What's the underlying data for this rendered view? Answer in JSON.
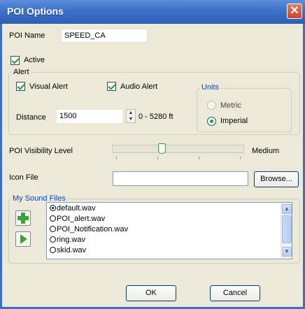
{
  "window": {
    "title": "POI Options",
    "close_glyph": "✕"
  },
  "poi_name": {
    "label": "POI Name",
    "value": "SPEED_CA"
  },
  "active": {
    "label": "Active",
    "checked": true
  },
  "alert": {
    "group_title": "Alert",
    "visual": {
      "label": "Visual Alert",
      "checked": true
    },
    "audio": {
      "label": "Audio Alert",
      "checked": true
    },
    "distance": {
      "label": "Distance",
      "value": "1500",
      "range": "0 - 5280 ft"
    },
    "units": {
      "group_title": "Units",
      "options": [
        {
          "label": "Metric",
          "selected": false
        },
        {
          "label": "Imperial",
          "selected": true
        }
      ]
    }
  },
  "visibility": {
    "label": "POI Visibility Level",
    "value_text": "Medium",
    "level_fraction": 0.37
  },
  "icon_file": {
    "label": "Icon File",
    "value": "",
    "browse_label": "Browse..."
  },
  "sound_files": {
    "group_title": "My Sound Files",
    "items": [
      {
        "label": "default.wav",
        "selected": true
      },
      {
        "label": "POI_alert.wav",
        "selected": false
      },
      {
        "label": "POI_Notification.wav",
        "selected": false
      },
      {
        "label": "ring.wav",
        "selected": false
      },
      {
        "label": "skid.wav",
        "selected": false
      }
    ],
    "add_icon": "plus-icon",
    "play_icon": "play-icon"
  },
  "buttons": {
    "ok": "OK",
    "cancel": "Cancel"
  },
  "colors": {
    "titlebar": "#3e71c9",
    "dialog_bg": "#ece9d8",
    "group_title": "#0046d5",
    "accent_green": "#21a121"
  }
}
